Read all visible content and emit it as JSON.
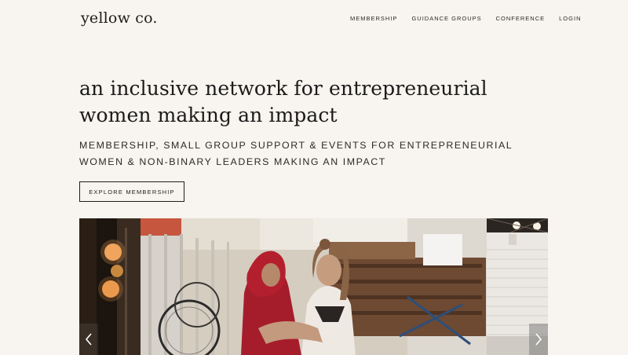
{
  "header": {
    "logo": "yellow co.",
    "nav": [
      {
        "label": "Membership"
      },
      {
        "label": "Guidance Groups"
      },
      {
        "label": "Conference"
      },
      {
        "label": "Login"
      }
    ]
  },
  "hero": {
    "headline": "an inclusive network for entrepreneurial women making an impact",
    "subhead": "Membership, small group support & events for entrepreneurial women & non-binary leaders making an impact",
    "cta_label": "Explore Membership"
  },
  "carousel": {
    "prev_icon": "chevron-left-icon",
    "next_icon": "chevron-right-icon"
  }
}
